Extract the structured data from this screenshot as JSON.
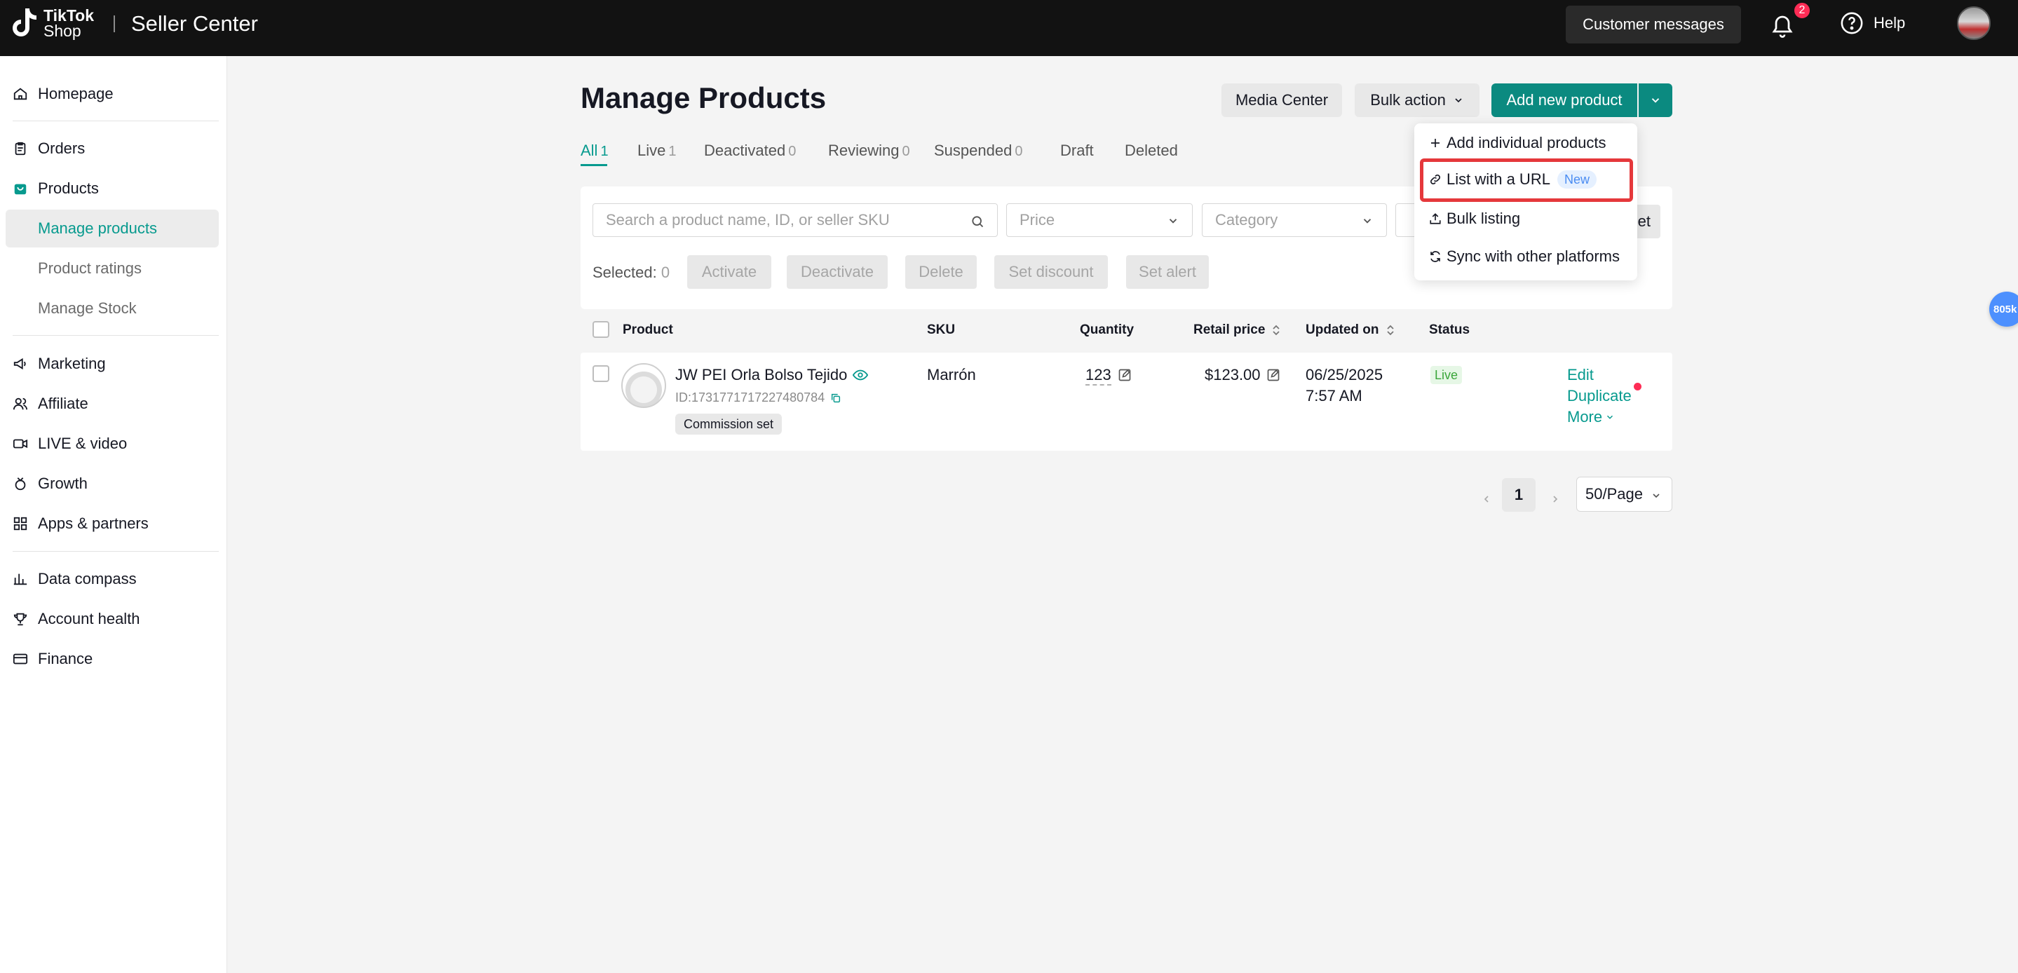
{
  "header": {
    "logo_line1": "TikTok",
    "logo_line2": "Shop",
    "app_title": "Seller Center",
    "customer_messages": "Customer messages",
    "notification_count": "2",
    "help": "Help"
  },
  "sidebar": {
    "homepage": "Homepage",
    "orders": "Orders",
    "products": "Products",
    "products_sub": [
      "Manage products",
      "Product ratings",
      "Manage Stock"
    ],
    "marketing": "Marketing",
    "affiliate": "Affiliate",
    "live_video": "LIVE & video",
    "growth": "Growth",
    "apps_partners": "Apps & partners",
    "data_compass": "Data compass",
    "account_health": "Account health",
    "finance": "Finance"
  },
  "main": {
    "title": "Manage Products",
    "media_center": "Media Center",
    "bulk_action": "Bulk action",
    "add_new_product": "Add new product",
    "tabs": [
      {
        "label": "All",
        "count": "1"
      },
      {
        "label": "Live",
        "count": "1"
      },
      {
        "label": "Deactivated",
        "count": "0"
      },
      {
        "label": "Reviewing",
        "count": "0"
      },
      {
        "label": "Suspended",
        "count": "0"
      },
      {
        "label": "Draft",
        "count": ""
      },
      {
        "label": "Deleted",
        "count": ""
      }
    ],
    "search_placeholder": "Search a product name, ID, or seller SKU",
    "price_placeholder": "Price",
    "category_placeholder": "Category",
    "reset_fragment": "et",
    "selected_label": "Selected:",
    "selected_count": "0",
    "bulk_buttons": [
      "Activate",
      "Deactivate",
      "Delete",
      "Set discount",
      "Set alert"
    ],
    "columns": [
      "Product",
      "SKU",
      "Quantity",
      "Retail price",
      "Updated on",
      "Status"
    ],
    "rows": [
      {
        "name": "JW PEI Orla Bolso Tejido",
        "id": "ID:1731771717227480784",
        "tag": "Commission set",
        "sku": "Marrón",
        "quantity": "123",
        "price": "$123.00",
        "updated_date": "06/25/2025",
        "updated_time": "7:57 AM",
        "status": "Live",
        "actions": [
          "Edit",
          "Duplicate",
          "More"
        ]
      }
    ],
    "pagination": {
      "current_page": "1",
      "page_size": "50/Page"
    }
  },
  "dropdown": {
    "items": [
      "Add individual products",
      "List with a URL",
      "Bulk listing",
      "Sync with other platforms"
    ],
    "new_badge": "New"
  },
  "float_badge": "805k",
  "colors": {
    "accent": "#0b8a80",
    "active_text": "#079a8e",
    "topbar": "#121212",
    "highlight": "#e5383b"
  }
}
